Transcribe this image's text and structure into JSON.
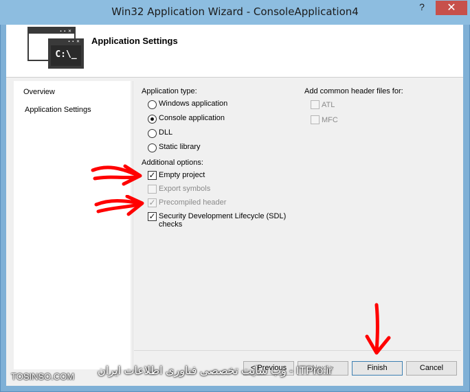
{
  "window": {
    "title": "Win32 Application Wizard - ConsoleApplication4",
    "help_glyph": "?",
    "close_glyph": "✕"
  },
  "header": {
    "title": "Application Settings",
    "icon_text": "C:\\_"
  },
  "nav": {
    "items": [
      {
        "label": "Overview"
      },
      {
        "label": "Application Settings"
      }
    ]
  },
  "application_type": {
    "label": "Application type:",
    "options": [
      {
        "label": "Windows application",
        "selected": false
      },
      {
        "label": "Console application",
        "selected": true
      },
      {
        "label": "DLL",
        "selected": false
      },
      {
        "label": "Static library",
        "selected": false
      }
    ]
  },
  "additional_options": {
    "label": "Additional options:",
    "options": [
      {
        "label": "Empty project",
        "checked": true,
        "enabled": true
      },
      {
        "label": "Export symbols",
        "checked": false,
        "enabled": false
      },
      {
        "label": "Precompiled header",
        "checked": true,
        "enabled": false
      },
      {
        "label": "Security Development Lifecycle (SDL)",
        "label2": "checks",
        "checked": true,
        "enabled": true
      }
    ]
  },
  "common_headers": {
    "label": "Add common header files for:",
    "options": [
      {
        "label": "ATL",
        "checked": false,
        "enabled": false
      },
      {
        "label": "MFC",
        "checked": false,
        "enabled": false
      }
    ]
  },
  "buttons": {
    "previous": "< Previous",
    "next": "Next >",
    "finish": "Finish",
    "cancel": "Cancel"
  },
  "watermark": {
    "left": "TOSINSO.COM",
    "right": "ITPro.ir - وب سایت تخصصی فناوری اطلاعات ایران"
  },
  "colors": {
    "frame": "#8dbde0",
    "close": "#c7504b",
    "annotation": "#ff0000"
  }
}
